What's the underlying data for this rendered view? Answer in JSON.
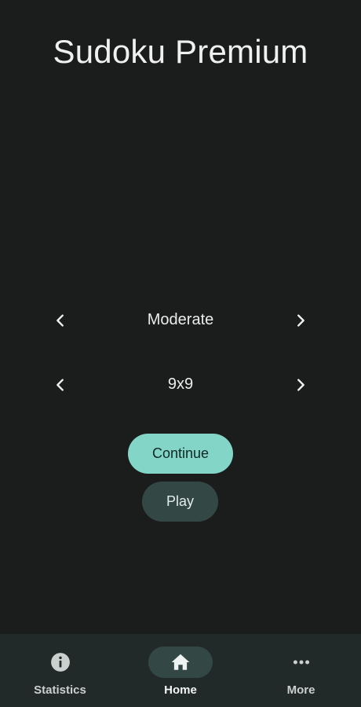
{
  "app": {
    "title": "Sudoku Premium"
  },
  "selectors": {
    "difficulty": {
      "value": "Moderate"
    },
    "size": {
      "value": "9x9"
    }
  },
  "buttons": {
    "continue_label": "Continue",
    "play_label": "Play"
  },
  "nav": {
    "items": [
      {
        "label": "Statistics",
        "icon": "info-icon"
      },
      {
        "label": "Home",
        "icon": "home-icon",
        "selected": true
      },
      {
        "label": "More",
        "icon": "more-horizontal-icon"
      }
    ]
  },
  "colors": {
    "background": "#1b1c1c",
    "accent": "#83d5c7",
    "secondary_button": "#334845",
    "nav_bar": "#222a29"
  }
}
